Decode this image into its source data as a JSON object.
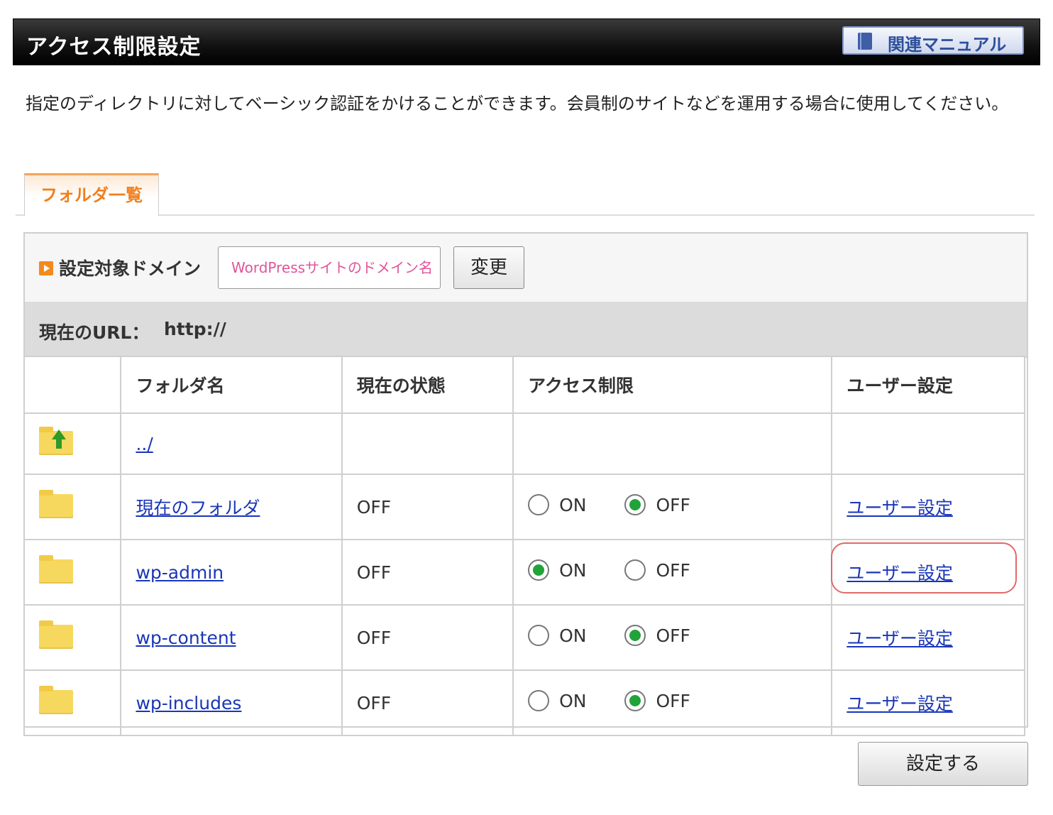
{
  "header": {
    "title": "アクセス制限設定",
    "manual_button": "関連マニュアル"
  },
  "description": "指定のディレクトリに対してベーシック認証をかけることができます。会員制のサイトなどを運用する場合に使用してください。",
  "tabs": [
    {
      "label": "フォルダ一覧",
      "active": true
    }
  ],
  "domain": {
    "label": "設定対象ドメイン",
    "selected": "WordPressサイトのドメイン名",
    "change_button": "変更"
  },
  "current_url": {
    "label": "現在のURL：",
    "value": "http://"
  },
  "table": {
    "headers": [
      "",
      "フォルダ名",
      "現在の状態",
      "アクセス制限",
      "ユーザー設定"
    ],
    "up_row": {
      "name": "../"
    },
    "rows": [
      {
        "name": "現在のフォルダ",
        "state": "OFF",
        "access": "OFF",
        "user_link": "ユーザー設定"
      },
      {
        "name": "wp-admin",
        "state": "OFF",
        "access": "ON",
        "user_link": "ユーザー設定"
      },
      {
        "name": "wp-content",
        "state": "OFF",
        "access": "OFF",
        "user_link": "ユーザー設定"
      },
      {
        "name": "wp-includes",
        "state": "OFF",
        "access": "OFF",
        "user_link": "ユーザー設定"
      }
    ],
    "radio_on_label": "ON",
    "radio_off_label": "OFF"
  },
  "colors": {
    "accent_orange": "#f07f1d",
    "link_blue": "#1a36b8",
    "radio_green": "#21a33a",
    "highlight_red": "#e06a6a"
  },
  "submit_button": "設定する"
}
